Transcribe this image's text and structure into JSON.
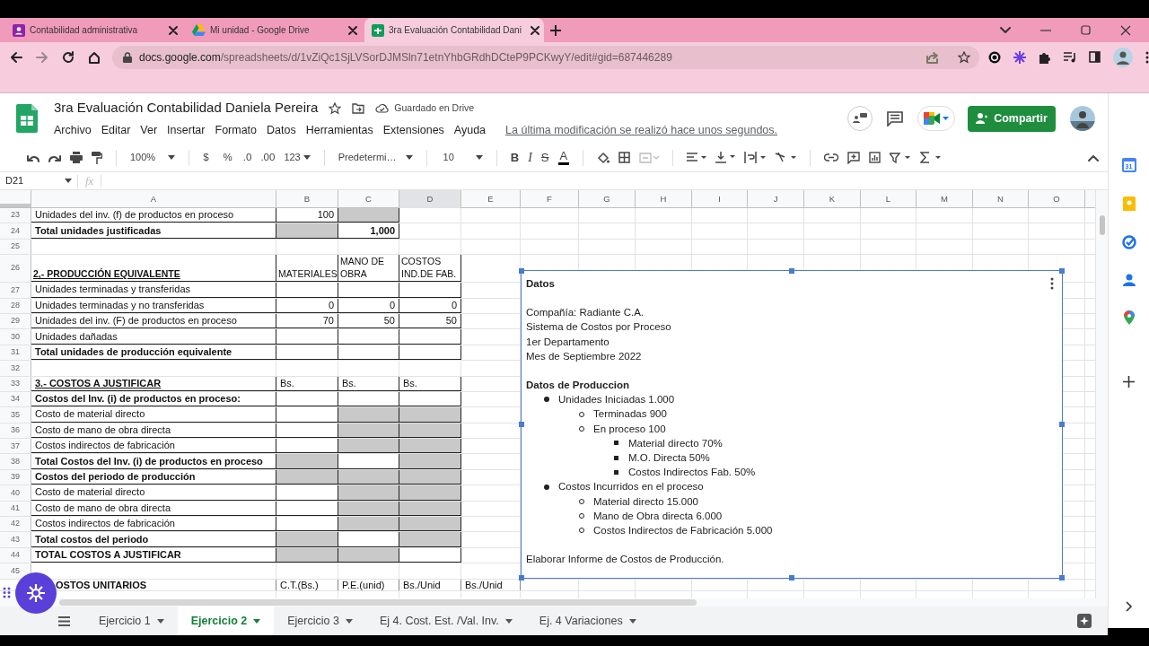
{
  "browser": {
    "tabs": [
      {
        "title": "Contabilidad administrativa",
        "selected": false
      },
      {
        "title": "Mi unidad - Google Drive",
        "selected": false
      },
      {
        "title": "3ra Evaluación Contabilidad Dani",
        "selected": true
      }
    ],
    "url_host": "docs.google.com",
    "url_path": "/spreadsheets/d/1vZiQc1SjLVSorDJMSln71etnYhbGRdhDCteP9PCKwyY/edit#gid=687446289"
  },
  "document": {
    "title": "3ra Evaluación Contabilidad Daniela Pereira",
    "save_status": "Guardado en Drive",
    "menu": [
      "Archivo",
      "Editar",
      "Ver",
      "Insertar",
      "Formato",
      "Datos",
      "Herramientas",
      "Extensiones",
      "Ayuda"
    ],
    "last_edit": "La última modificación se realizó hace unos segundos.",
    "share_button": "Compartir"
  },
  "toolbar": {
    "zoom": "100%",
    "currency": "$",
    "percent": "%",
    "decrease_decimals": ".0",
    "increase_decimals": ".00",
    "number_format": "123",
    "font": "Predetermi…",
    "font_size": "10",
    "bold": "B",
    "italic": "I",
    "strikethrough": "S",
    "text_color": "A"
  },
  "formula_bar": {
    "cell_ref": "D21",
    "fx": "fx"
  },
  "columns": [
    {
      "label": "A",
      "selected": false
    },
    {
      "label": "B",
      "selected": false
    },
    {
      "label": "C",
      "selected": false
    },
    {
      "label": "D",
      "selected": true
    },
    {
      "label": "E",
      "selected": false
    },
    {
      "label": "F",
      "selected": false
    },
    {
      "label": "G",
      "selected": false
    },
    {
      "label": "H",
      "selected": false
    },
    {
      "label": "I",
      "selected": false
    },
    {
      "label": "J",
      "selected": false
    },
    {
      "label": "K",
      "selected": false
    },
    {
      "label": "L",
      "selected": false
    },
    {
      "label": "M",
      "selected": false
    },
    {
      "label": "N",
      "selected": false
    },
    {
      "label": "O",
      "selected": false
    }
  ],
  "rows": [
    {
      "number": "23",
      "kind": "normal",
      "cells": [
        {
          "kind": "text",
          "text": "Unidades del inv. (f) de productos en proceso",
          "bold": false,
          "underline": false,
          "shaded": false
        },
        {
          "kind": "number",
          "text": "100",
          "bold": false,
          "underline": false,
          "shaded": false
        },
        {
          "shaded": true
        }
      ]
    },
    {
      "number": "24",
      "kind": "normal",
      "cells": [
        {
          "kind": "text",
          "text": "Total unidades justificadas",
          "bold": true,
          "underline": false,
          "shaded": false
        },
        {
          "shaded": true
        },
        {
          "kind": "number",
          "text": "1,000",
          "bold": true,
          "underline": false,
          "shaded": false
        }
      ]
    },
    {
      "number": "25",
      "kind": "normal",
      "cells": []
    },
    {
      "number": "26",
      "kind": "header",
      "cells": [
        {
          "kind": "text",
          "text": "2,- PRODUCCIÓN EQUIVALENTE",
          "bold": true,
          "underline": true,
          "shaded": false
        },
        {
          "kind": "text",
          "text": "MATERIALES",
          "bold": false,
          "underline": false,
          "shaded": false
        },
        {
          "kind": "text",
          "text": "MANO DE OBRA",
          "bold": false,
          "underline": false,
          "shaded": false
        },
        {
          "kind": "text",
          "text": "COSTOS IND.DE FAB.",
          "bold": false,
          "underline": false,
          "shaded": false
        }
      ]
    },
    {
      "number": "27",
      "kind": "normal",
      "cells": [
        {
          "kind": "text",
          "text": "Unidades terminadas y transferidas",
          "bold": false,
          "underline": false,
          "shaded": false
        },
        {
          "shaded": false
        },
        {
          "shaded": false
        },
        {
          "shaded": false
        }
      ]
    },
    {
      "number": "28",
      "kind": "normal",
      "cells": [
        {
          "kind": "text",
          "text": "Unidades terminadas y  no transferidas",
          "bold": false,
          "underline": false,
          "shaded": false
        },
        {
          "kind": "number",
          "text": "0",
          "bold": false,
          "underline": false,
          "shaded": false
        },
        {
          "kind": "number",
          "text": "0",
          "bold": false,
          "underline": false,
          "shaded": false
        },
        {
          "kind": "number",
          "text": "0",
          "bold": false,
          "underline": false,
          "shaded": false
        }
      ]
    },
    {
      "number": "29",
      "kind": "normal",
      "cells": [
        {
          "kind": "text",
          "text": "Unidades del inv. (F) de productos en proceso",
          "bold": false,
          "underline": false,
          "shaded": false
        },
        {
          "kind": "number",
          "text": "70",
          "bold": false,
          "underline": false,
          "shaded": false
        },
        {
          "kind": "number",
          "text": "50",
          "bold": false,
          "underline": false,
          "shaded": false
        },
        {
          "kind": "number",
          "text": "50",
          "bold": false,
          "underline": false,
          "shaded": false
        }
      ]
    },
    {
      "number": "30",
      "kind": "normal",
      "cells": [
        {
          "kind": "text",
          "text": "Unidades dañadas",
          "bold": false,
          "underline": false,
          "shaded": false
        },
        {
          "shaded": false
        },
        {
          "shaded": false
        },
        {
          "shaded": false
        }
      ]
    },
    {
      "number": "31",
      "kind": "normal",
      "cells": [
        {
          "kind": "text",
          "text": "Total unidades de producción equivalente",
          "bold": true,
          "underline": false,
          "shaded": false
        },
        {
          "shaded": false
        },
        {
          "shaded": false
        },
        {
          "shaded": false
        }
      ]
    },
    {
      "number": "32",
      "kind": "normal",
      "cells": []
    },
    {
      "number": "33",
      "kind": "normal",
      "cells": [
        {
          "kind": "text",
          "text": "3.- COSTOS A JUSTIFICAR",
          "bold": true,
          "underline": true,
          "shaded": false
        },
        {
          "kind": "text",
          "text": "Bs.",
          "bold": false,
          "underline": false,
          "shaded": false
        },
        {
          "kind": "text",
          "text": "Bs.",
          "bold": false,
          "underline": false,
          "shaded": false
        },
        {
          "kind": "text",
          "text": "Bs.",
          "bold": false,
          "underline": false,
          "shaded": false
        }
      ]
    },
    {
      "number": "34",
      "kind": "normal",
      "cells": [
        {
          "kind": "text",
          "text": "Costos del Inv. (i) de productos en proceso:",
          "bold": true,
          "underline": false,
          "shaded": false
        },
        {
          "shaded": false
        },
        {
          "shaded": false
        },
        {
          "shaded": false
        }
      ]
    },
    {
      "number": "35",
      "kind": "normal",
      "cells": [
        {
          "kind": "text",
          "text": "Costo de material directo",
          "bold": false,
          "underline": false,
          "shaded": false
        },
        {
          "shaded": false
        },
        {
          "shaded": true
        },
        {
          "shaded": true
        }
      ]
    },
    {
      "number": "36",
      "kind": "normal",
      "cells": [
        {
          "kind": "text",
          "text": "Costo de mano de obra directa",
          "bold": false,
          "underline": false,
          "shaded": false
        },
        {
          "shaded": false
        },
        {
          "shaded": true
        },
        {
          "shaded": true
        }
      ]
    },
    {
      "number": "37",
      "kind": "normal",
      "cells": [
        {
          "kind": "text",
          "text": "Costos indirectos de fabricación",
          "bold": false,
          "underline": false,
          "shaded": false
        },
        {
          "shaded": false
        },
        {
          "shaded": true
        },
        {
          "shaded": true
        }
      ]
    },
    {
      "number": "38",
      "kind": "normal",
      "cells": [
        {
          "kind": "text",
          "text": "Total Costos del Inv. (i) de productos en proceso",
          "bold": true,
          "underline": false,
          "shaded": false
        },
        {
          "shaded": true
        },
        {
          "shaded": false
        },
        {
          "shaded": true
        }
      ]
    },
    {
      "number": "39",
      "kind": "normal",
      "cells": [
        {
          "kind": "text",
          "text": "Costos del  periodo de producción",
          "bold": true,
          "underline": false,
          "shaded": false
        },
        {
          "shaded": true
        },
        {
          "shaded": true
        },
        {
          "shaded": true
        }
      ]
    },
    {
      "number": "40",
      "kind": "normal",
      "cells": [
        {
          "kind": "text",
          "text": "Costo de material directo",
          "bold": false,
          "underline": false,
          "shaded": false
        },
        {
          "shaded": false
        },
        {
          "shaded": true
        },
        {
          "shaded": true
        }
      ]
    },
    {
      "number": "41",
      "kind": "normal",
      "cells": [
        {
          "kind": "text",
          "text": "Costo de mano de obra directa",
          "bold": false,
          "underline": false,
          "shaded": false
        },
        {
          "shaded": false
        },
        {
          "shaded": true
        },
        {
          "shaded": true
        }
      ]
    },
    {
      "number": "42",
      "kind": "normal",
      "cells": [
        {
          "kind": "text",
          "text": "Costos indirectos de fabricación",
          "bold": false,
          "underline": false,
          "shaded": false
        },
        {
          "shaded": false
        },
        {
          "shaded": true
        },
        {
          "shaded": true
        }
      ]
    },
    {
      "number": "43",
      "kind": "normal",
      "cells": [
        {
          "kind": "text",
          "text": "Total costos del periodo",
          "bold": true,
          "underline": false,
          "shaded": false
        },
        {
          "shaded": true
        },
        {
          "shaded": false
        },
        {
          "shaded": true
        }
      ]
    },
    {
      "number": "44",
      "kind": "normal",
      "cells": [
        {
          "kind": "text",
          "text": "TOTAL COSTOS A JUSTIFICAR",
          "bold": true,
          "underline": false,
          "shaded": false
        },
        {
          "shaded": true
        },
        {
          "shaded": true
        },
        {
          "shaded": false
        }
      ]
    },
    {
      "number": "45",
      "kind": "normal",
      "cells": []
    },
    {
      "kind": "partial",
      "cells": [
        {
          "kind": "text",
          "text": "OSTOS UNITARIOS",
          "bold": true,
          "underline": false,
          "shaded": false
        },
        {
          "kind": "text",
          "text": "C.T.(Bs.)",
          "bold": false,
          "underline": false,
          "shaded": false
        },
        {
          "kind": "text",
          "text": "P.E.(unid)",
          "bold": false,
          "underline": false,
          "shaded": false
        },
        {
          "kind": "text",
          "text": "Bs./Unid",
          "bold": false,
          "underline": false,
          "shaded": false
        },
        {
          "kind": "text",
          "text": "Bs./Unid",
          "bold": false,
          "underline": false,
          "shaded": false
        }
      ]
    }
  ],
  "text_box": {
    "title": "Datos",
    "lines": [
      "Compañía: Radiante C.A.",
      "Sistema de Costos por Proceso",
      "1er Departamento",
      "Mes de Septiembre 2022"
    ],
    "heading": "Datos de Produccion",
    "list": [
      {
        "text": "Unidades Iniciadas 1.000",
        "children": [
          {
            "text": "Terminadas 900"
          },
          {
            "text": "En proceso 100",
            "children": [
              {
                "text": "Material directo 70%"
              },
              {
                "text": "M.O. Directa 50%"
              },
              {
                "text": "Costos Indirectos Fab. 50%"
              }
            ]
          }
        ]
      },
      {
        "text": "Costos Incurridos en el proceso",
        "children": [
          {
            "text": "Material directo 15.000"
          },
          {
            "text": "Mano de Obra directa 6.000"
          },
          {
            "text": "Costos Indirectos de Fabricación 5.000"
          }
        ]
      }
    ],
    "footer": "Elaborar Informe de Costos de Producción."
  },
  "sheet_tabs": [
    {
      "label": "Ejercicio 1",
      "selected": false
    },
    {
      "label": "Ejercicio 2",
      "selected": true
    },
    {
      "label": "Ejercicio 3",
      "selected": false
    },
    {
      "label": "Ej 4. Cost. Est. /Val. Inv.",
      "selected": false
    },
    {
      "label": "Ej. 4 Variaciones",
      "selected": false
    }
  ],
  "side_panel": {
    "calendar_day": "31"
  }
}
